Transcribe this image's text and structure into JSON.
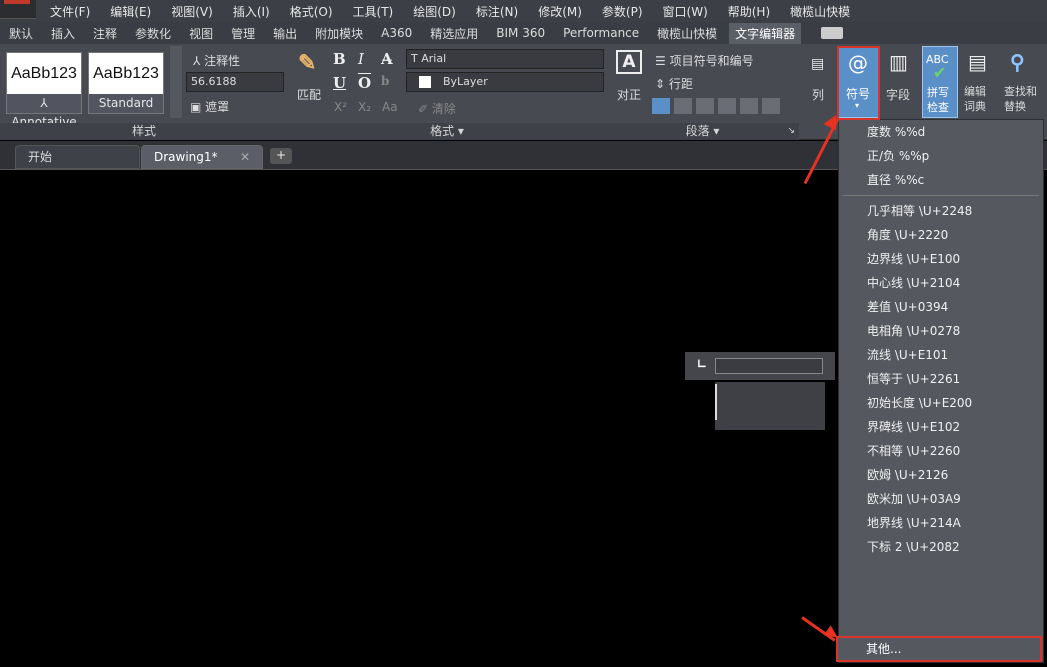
{
  "menu": [
    "文件(F)",
    "编辑(E)",
    "视图(V)",
    "插入(I)",
    "格式(O)",
    "工具(T)",
    "绘图(D)",
    "标注(N)",
    "修改(M)",
    "参数(P)",
    "窗口(W)",
    "帮助(H)",
    "橄榄山快模"
  ],
  "ribbon_tabs": [
    "默认",
    "插入",
    "注释",
    "参数化",
    "视图",
    "管理",
    "输出",
    "附加模块",
    "A360",
    "精选应用",
    "BIM 360",
    "Performance",
    "橄榄山快模",
    "文字编辑器"
  ],
  "active_tab_index": 13,
  "styles": {
    "card1_sample": "AaBb123",
    "card1_caption": "Annotative",
    "card2_sample": "AaBb123",
    "card2_caption": "Standard",
    "annotative_label": "注释性",
    "height_value": "56.6188",
    "mask_label": "遮罩",
    "panel_label": "样式"
  },
  "format": {
    "match_label": "匹配",
    "font": "Arial",
    "color": "ByLayer",
    "clear_label": "清除",
    "case_label": "Aa",
    "panel_label": "格式 ▾"
  },
  "paragraph": {
    "justify_label": "对正",
    "bullets_label": "项目符号和编号",
    "spacing_label": "行距",
    "panel_label": "段落 ▾",
    "corner": "↘"
  },
  "insert": {
    "column_label": "列",
    "symbol_label": "符号",
    "field_label": "字段",
    "spell_label": "拼写检查",
    "dict_label": "编辑词典",
    "find_label": "查找和替换",
    "abc": "ABC",
    "at": "@"
  },
  "drawing_tabs": {
    "start": "开始",
    "drawing": "Drawing1*",
    "close": "✕",
    "plus": "+"
  },
  "symbol_menu": [
    "度数  %%d",
    "正/负  %%p",
    "直径  %%c",
    "几乎相等  \\U+2248",
    "角度  \\U+2220",
    "边界线  \\U+E100",
    "中心线  \\U+2104",
    "差值  \\U+0394",
    "电相角  \\U+0278",
    "流线  \\U+E101",
    "恒等于  \\U+2261",
    "初始长度  \\U+E200",
    "界碑线  \\U+E102",
    "不相等  \\U+2260",
    "欧姆  \\U+2126",
    "欧米加  \\U+03A9",
    "地界线  \\U+214A",
    "下标 2  \\U+2082"
  ],
  "other_label": "其他...",
  "colors": {
    "accent": "#5a8fc8",
    "highlight": "#d9342b"
  }
}
